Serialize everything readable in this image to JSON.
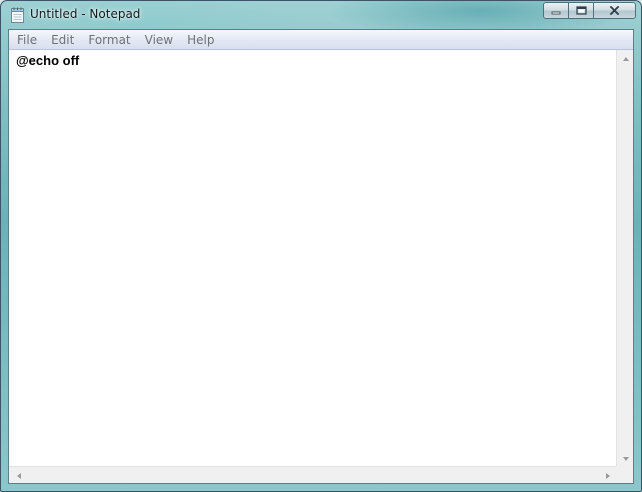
{
  "window": {
    "title": "Untitled - Notepad",
    "icon": "notepad-icon",
    "caption_buttons": [
      "minimize-icon",
      "maximize-icon",
      "close-icon"
    ]
  },
  "menubar": {
    "items": [
      "File",
      "Edit",
      "Format",
      "View",
      "Help"
    ]
  },
  "editor": {
    "text": "@echo off"
  },
  "colors": {
    "frame": "#7fbfc3",
    "menubar": "#e4e9f3",
    "menu_text": "#6d7178",
    "editor_background": "#ffffff"
  }
}
